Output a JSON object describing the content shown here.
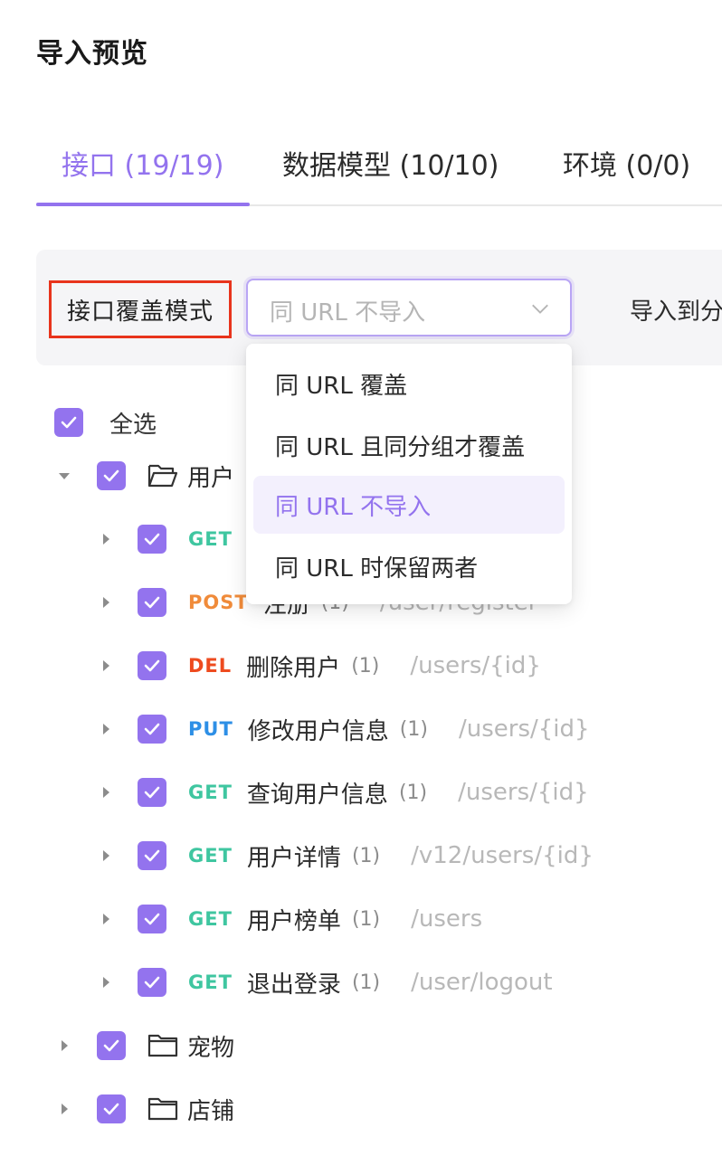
{
  "page": {
    "title": "导入预览"
  },
  "tabs": [
    {
      "label": "接口 (19/19)",
      "active": true
    },
    {
      "label": "数据模型 (10/10)",
      "active": false
    },
    {
      "label": "环境 (0/0)",
      "active": false
    }
  ],
  "toolbar": {
    "mode_label": "接口覆盖模式",
    "select_value": "同 URL 不导入",
    "import_to_label": "导入到分"
  },
  "dropdown": {
    "options": [
      {
        "label": "同 URL 覆盖"
      },
      {
        "label": "同 URL 且同分组才覆盖"
      },
      {
        "label": "同 URL 不导入",
        "selected": true
      },
      {
        "label": "同 URL 时保留两者"
      }
    ]
  },
  "tree": {
    "select_all_label": "全选",
    "folders": [
      {
        "name": "用户",
        "expanded": true
      },
      {
        "name": "宠物",
        "expanded": false
      },
      {
        "name": "店铺",
        "expanded": false
      }
    ],
    "apis": [
      {
        "method": "GET",
        "name": "",
        "count": "",
        "path": ""
      },
      {
        "method": "POST",
        "name": "注册",
        "count": "(1)",
        "path": "/user/register"
      },
      {
        "method": "DEL",
        "name": "删除用户",
        "count": "(1)",
        "path": "/users/{id}"
      },
      {
        "method": "PUT",
        "name": "修改用户信息",
        "count": "(1)",
        "path": "/users/{id}"
      },
      {
        "method": "GET",
        "name": "查询用户信息",
        "count": "(1)",
        "path": "/users/{id}"
      },
      {
        "method": "GET",
        "name": "用户详情",
        "count": "(1)",
        "path": "/v12/users/{id}"
      },
      {
        "method": "GET",
        "name": "用户榜单",
        "count": "(1)",
        "path": "/users"
      },
      {
        "method": "GET",
        "name": "退出登录",
        "count": "(1)",
        "path": "/user/logout"
      }
    ]
  },
  "colors": {
    "accent": "#9373ee",
    "get": "#3fc6a0",
    "post": "#f08b3a",
    "del": "#ee4b1f",
    "put": "#2d8fe6",
    "highlight_border": "#e8341c"
  }
}
